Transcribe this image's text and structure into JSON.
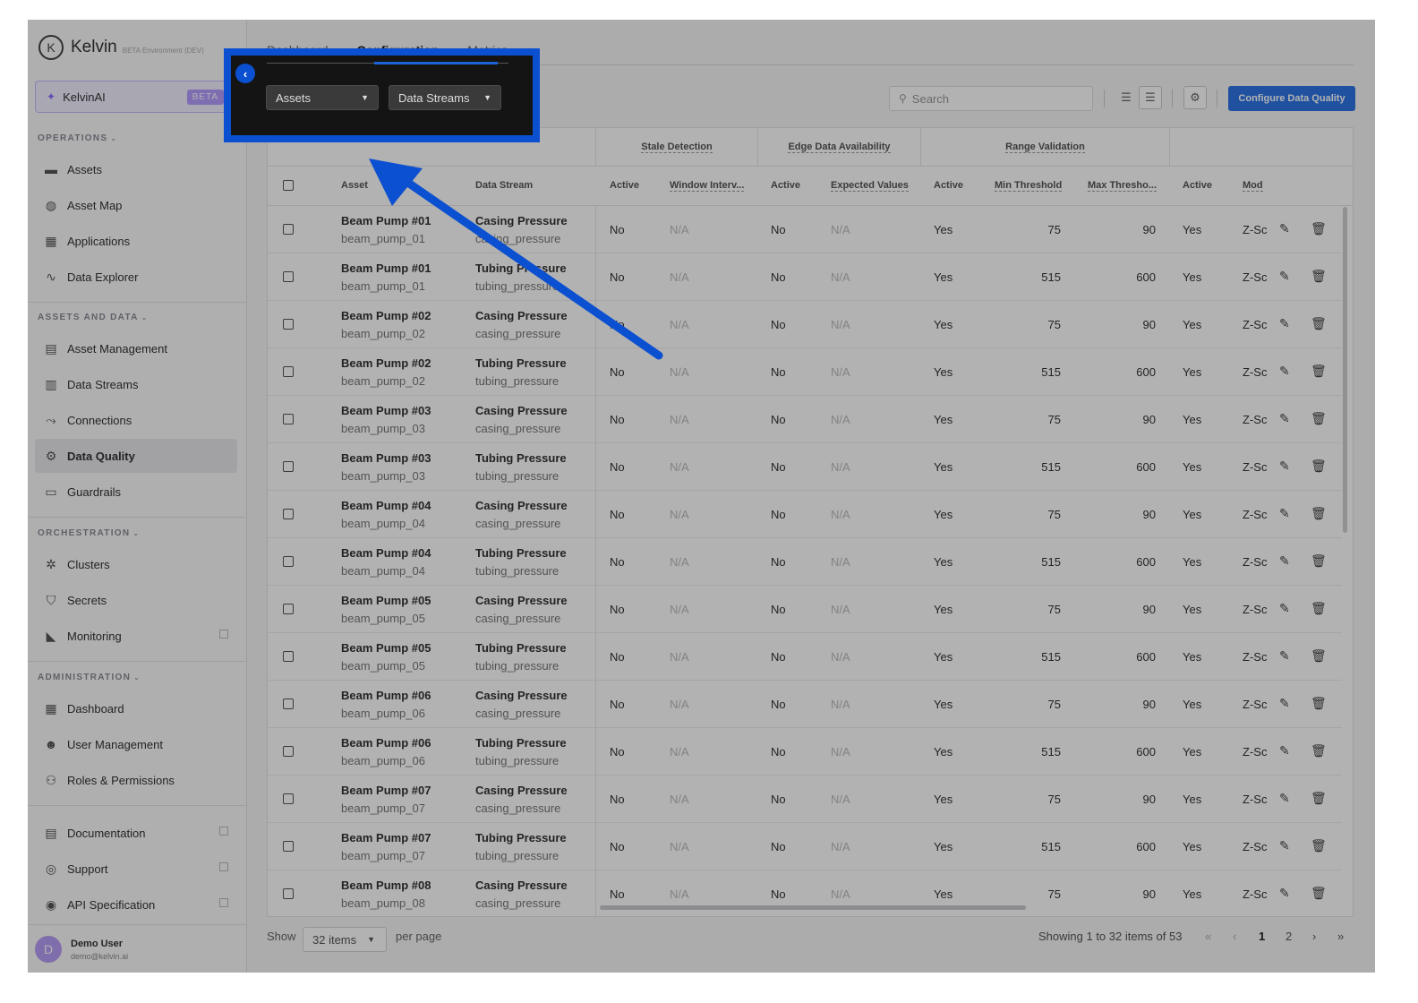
{
  "brand": {
    "name": "Kelvin",
    "env": "BETA Environment (DEV)",
    "logo_letter": "K"
  },
  "ai": {
    "label": "KelvinAI",
    "badge": "BETA"
  },
  "sidebar": {
    "sections": [
      {
        "title": "OPERATIONS",
        "items": [
          "Assets",
          "Asset Map",
          "Applications",
          "Data Explorer"
        ]
      },
      {
        "title": "ASSETS AND DATA",
        "items": [
          "Asset Management",
          "Data Streams",
          "Connections",
          "Data Quality",
          "Guardrails"
        ]
      },
      {
        "title": "ORCHESTRATION",
        "items": [
          "Clusters",
          "Secrets",
          "Monitoring"
        ]
      },
      {
        "title": "ADMINISTRATION",
        "items": [
          "Dashboard",
          "User Management",
          "Roles & Permissions"
        ]
      }
    ],
    "bottom_items": [
      "Documentation",
      "Support",
      "API Specification"
    ],
    "active_item": "Data Quality"
  },
  "user": {
    "initial": "D",
    "name": "Demo User",
    "email": "demo@kelvin.ai"
  },
  "tabs": [
    "Dashboard",
    "Configuration",
    "Metrics"
  ],
  "toolbar": {
    "assets_dropdown": "Assets",
    "streams_dropdown": "Data Streams",
    "search_placeholder": "Search",
    "configure_button": "Configure Data Quality"
  },
  "table": {
    "groups": [
      "Stale Detection",
      "Edge Data Availability",
      "Range Validation"
    ],
    "columns": [
      "Asset",
      "Data Stream",
      "Active",
      "Window Interv...",
      "Active",
      "Expected Values",
      "Active",
      "Min Threshold",
      "Max Thresho...",
      "Active",
      "Mod"
    ],
    "rows": [
      {
        "asset": "Beam Pump #01",
        "asset_id": "beam_pump_01",
        "stream": "Casing Pressure",
        "stream_id": "casing_pressure",
        "stale_active": "No",
        "window": "N/A",
        "edge_active": "No",
        "expected": "N/A",
        "range_active": "Yes",
        "min": "75",
        "max": "90",
        "mod_active": "Yes",
        "mod": "Z-Sc"
      },
      {
        "asset": "Beam Pump #01",
        "asset_id": "beam_pump_01",
        "stream": "Tubing Pressure",
        "stream_id": "tubing_pressure",
        "stale_active": "No",
        "window": "N/A",
        "edge_active": "No",
        "expected": "N/A",
        "range_active": "Yes",
        "min": "515",
        "max": "600",
        "mod_active": "Yes",
        "mod": "Z-Sc"
      },
      {
        "asset": "Beam Pump #02",
        "asset_id": "beam_pump_02",
        "stream": "Casing Pressure",
        "stream_id": "casing_pressure",
        "stale_active": "No",
        "window": "N/A",
        "edge_active": "No",
        "expected": "N/A",
        "range_active": "Yes",
        "min": "75",
        "max": "90",
        "mod_active": "Yes",
        "mod": "Z-Sc"
      },
      {
        "asset": "Beam Pump #02",
        "asset_id": "beam_pump_02",
        "stream": "Tubing Pressure",
        "stream_id": "tubing_pressure",
        "stale_active": "No",
        "window": "N/A",
        "edge_active": "No",
        "expected": "N/A",
        "range_active": "Yes",
        "min": "515",
        "max": "600",
        "mod_active": "Yes",
        "mod": "Z-Sc"
      },
      {
        "asset": "Beam Pump #03",
        "asset_id": "beam_pump_03",
        "stream": "Casing Pressure",
        "stream_id": "casing_pressure",
        "stale_active": "No",
        "window": "N/A",
        "edge_active": "No",
        "expected": "N/A",
        "range_active": "Yes",
        "min": "75",
        "max": "90",
        "mod_active": "Yes",
        "mod": "Z-Sc"
      },
      {
        "asset": "Beam Pump #03",
        "asset_id": "beam_pump_03",
        "stream": "Tubing Pressure",
        "stream_id": "tubing_pressure",
        "stale_active": "No",
        "window": "N/A",
        "edge_active": "No",
        "expected": "N/A",
        "range_active": "Yes",
        "min": "515",
        "max": "600",
        "mod_active": "Yes",
        "mod": "Z-Sc"
      },
      {
        "asset": "Beam Pump #04",
        "asset_id": "beam_pump_04",
        "stream": "Casing Pressure",
        "stream_id": "casing_pressure",
        "stale_active": "No",
        "window": "N/A",
        "edge_active": "No",
        "expected": "N/A",
        "range_active": "Yes",
        "min": "75",
        "max": "90",
        "mod_active": "Yes",
        "mod": "Z-Sc"
      },
      {
        "asset": "Beam Pump #04",
        "asset_id": "beam_pump_04",
        "stream": "Tubing Pressure",
        "stream_id": "tubing_pressure",
        "stale_active": "No",
        "window": "N/A",
        "edge_active": "No",
        "expected": "N/A",
        "range_active": "Yes",
        "min": "515",
        "max": "600",
        "mod_active": "Yes",
        "mod": "Z-Sc"
      },
      {
        "asset": "Beam Pump #05",
        "asset_id": "beam_pump_05",
        "stream": "Casing Pressure",
        "stream_id": "casing_pressure",
        "stale_active": "No",
        "window": "N/A",
        "edge_active": "No",
        "expected": "N/A",
        "range_active": "Yes",
        "min": "75",
        "max": "90",
        "mod_active": "Yes",
        "mod": "Z-Sc"
      },
      {
        "asset": "Beam Pump #05",
        "asset_id": "beam_pump_05",
        "stream": "Tubing Pressure",
        "stream_id": "tubing_pressure",
        "stale_active": "No",
        "window": "N/A",
        "edge_active": "No",
        "expected": "N/A",
        "range_active": "Yes",
        "min": "515",
        "max": "600",
        "mod_active": "Yes",
        "mod": "Z-Sc"
      },
      {
        "asset": "Beam Pump #06",
        "asset_id": "beam_pump_06",
        "stream": "Casing Pressure",
        "stream_id": "casing_pressure",
        "stale_active": "No",
        "window": "N/A",
        "edge_active": "No",
        "expected": "N/A",
        "range_active": "Yes",
        "min": "75",
        "max": "90",
        "mod_active": "Yes",
        "mod": "Z-Sc"
      },
      {
        "asset": "Beam Pump #06",
        "asset_id": "beam_pump_06",
        "stream": "Tubing Pressure",
        "stream_id": "tubing_pressure",
        "stale_active": "No",
        "window": "N/A",
        "edge_active": "No",
        "expected": "N/A",
        "range_active": "Yes",
        "min": "515",
        "max": "600",
        "mod_active": "Yes",
        "mod": "Z-Sc"
      },
      {
        "asset": "Beam Pump #07",
        "asset_id": "beam_pump_07",
        "stream": "Casing Pressure",
        "stream_id": "casing_pressure",
        "stale_active": "No",
        "window": "N/A",
        "edge_active": "No",
        "expected": "N/A",
        "range_active": "Yes",
        "min": "75",
        "max": "90",
        "mod_active": "Yes",
        "mod": "Z-Sc"
      },
      {
        "asset": "Beam Pump #07",
        "asset_id": "beam_pump_07",
        "stream": "Tubing Pressure",
        "stream_id": "tubing_pressure",
        "stale_active": "No",
        "window": "N/A",
        "edge_active": "No",
        "expected": "N/A",
        "range_active": "Yes",
        "min": "515",
        "max": "600",
        "mod_active": "Yes",
        "mod": "Z-Sc"
      },
      {
        "asset": "Beam Pump #08",
        "asset_id": "beam_pump_08",
        "stream": "Casing Pressure",
        "stream_id": "casing_pressure",
        "stale_active": "No",
        "window": "N/A",
        "edge_active": "No",
        "expected": "N/A",
        "range_active": "Yes",
        "min": "75",
        "max": "90",
        "mod_active": "Yes",
        "mod": "Z-Sc"
      }
    ]
  },
  "footer": {
    "show": "Show",
    "per_page_value": "32 items",
    "per_page": "per page",
    "showing": "Showing 1 to 32 items of 53",
    "pages": [
      "1",
      "2"
    ]
  },
  "colors": {
    "accent": "#0b50d0",
    "primary_button": "#2d74e6",
    "ai_badge": "#b79cff"
  }
}
